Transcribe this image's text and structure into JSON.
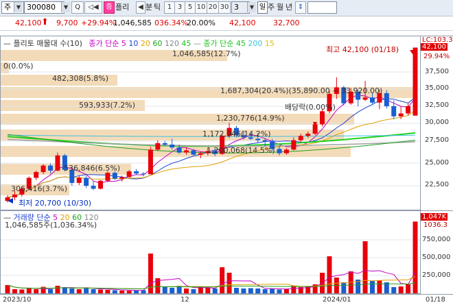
{
  "toolbar": {
    "type_label": "주",
    "code": "300080",
    "btn_search": "Q",
    "btn_speaker": "◁◀",
    "tag_jeung": "증",
    "company": "플리",
    "nav_left": "◀",
    "split_label": "분",
    "tick_label": "틱",
    "periods": [
      "1",
      "3",
      "5",
      "10",
      "20",
      "30"
    ],
    "period_selected": "3",
    "day_label": "일",
    "week_label": "주",
    "month_label": "월",
    "year_label": "년",
    "updown": "⇕"
  },
  "quote": {
    "price": "42,100",
    "change": "9,700",
    "change_pct": "+29.94%",
    "volume": "1,046,585",
    "vol_pct": "036.34%",
    "ratio": "20.00%",
    "high": "42,100",
    "low": "32,700"
  },
  "legend": {
    "name": "플리토 매물대 수(10)",
    "ma_label": "종가 단순",
    "ma_periods": [
      "5",
      "10",
      "20",
      "60",
      "120",
      "45"
    ],
    "ma_label2": "종가 단순",
    "ma_periods2": [
      "45",
      "200",
      "15"
    ],
    "vol_name": "거래량 단순",
    "vol_periods": [
      "5",
      "20",
      "60",
      "120"
    ],
    "vol_value": "1,046,585주(1,036.34%)"
  },
  "annotations": {
    "supply": [
      "1,046,585(12.7%)",
      "0(0.0%)",
      "482,308(5.8%)",
      "1,687,304(20.4%)(35,890.00 ~ 33,920.00)",
      "593,933(7.2%)",
      "1,230,776(14.9%)",
      "1,172,946(14.2%)",
      "1,200,068(14.5%)",
      "536,846(6.5%)",
      "306,416(3.7%)"
    ],
    "dividend": "배당락(0.00%)",
    "high_label": "최고 42,100 (01/18)",
    "low_label": "최저 20,700 (10/30)"
  },
  "price_axis": {
    "top_label": "LC:103.3",
    "current": "42,100",
    "current2": "29.94%",
    "ticks": [
      "37,500",
      "35,000",
      "32,500",
      "30,000",
      "27,500",
      "25,000",
      "22,500"
    ]
  },
  "vol_axis": {
    "current": "1,047K",
    "current2": "1036.3",
    "ticks": [
      "750,000",
      "500,000",
      "250,000"
    ]
  },
  "dates": [
    "2023/10",
    "12",
    "2024/01",
    "01/18"
  ],
  "colors": {
    "up": "#e8000b",
    "down": "#1a5fd0",
    "ma5": "#c000c0",
    "ma10": "#1a3fd0",
    "ma20": "#e0a000",
    "ma60": "#20a020",
    "ma120": "#a0a0a0",
    "ma45": "#20d020",
    "ma200": "#40c0e0",
    "supply": "#f0d2a8"
  },
  "chart_data": {
    "type": "candlestick",
    "ylim": [
      20000,
      43000
    ],
    "candles": [
      [
        20900,
        21700,
        20700,
        21400
      ],
      [
        21400,
        22300,
        21000,
        21800
      ],
      [
        21800,
        22900,
        21500,
        22600
      ],
      [
        22600,
        24300,
        22400,
        24100
      ],
      [
        24100,
        25100,
        23800,
        24900
      ],
      [
        24900,
        26000,
        24600,
        25800
      ],
      [
        25800,
        26100,
        24700,
        25100
      ],
      [
        25100,
        27600,
        25000,
        27200
      ],
      [
        27200,
        27400,
        25000,
        25200
      ],
      [
        25200,
        25600,
        23000,
        23400
      ],
      [
        23400,
        24400,
        23100,
        24100
      ],
      [
        24100,
        24400,
        22700,
        23000
      ],
      [
        23000,
        23700,
        22400,
        22600
      ],
      [
        22600,
        23800,
        22500,
        23700
      ],
      [
        23700,
        25000,
        23500,
        24800
      ],
      [
        24800,
        25000,
        23800,
        24000
      ],
      [
        24000,
        24400,
        23600,
        24200
      ],
      [
        24200,
        25200,
        24100,
        25000
      ],
      [
        25000,
        25300,
        24500,
        24700
      ],
      [
        24700,
        24900,
        24300,
        24600
      ],
      [
        24600,
        28400,
        24600,
        28000
      ],
      [
        28000,
        29300,
        27800,
        28900
      ],
      [
        28900,
        29200,
        28500,
        28700
      ],
      [
        28700,
        29500,
        28000,
        28300
      ],
      [
        28300,
        28700,
        27400,
        27600
      ],
      [
        27600,
        28300,
        27300,
        27900
      ],
      [
        27900,
        28100,
        27200,
        27300
      ],
      [
        27300,
        27700,
        26800,
        27500
      ],
      [
        27500,
        28200,
        27200,
        27800
      ],
      [
        27800,
        28100,
        27100,
        27400
      ],
      [
        27400,
        30100,
        27300,
        29900
      ],
      [
        29900,
        31700,
        29600,
        31000
      ],
      [
        31000,
        31300,
        29700,
        30000
      ],
      [
        30000,
        30600,
        29400,
        29700
      ],
      [
        29700,
        30300,
        29300,
        29500
      ],
      [
        29500,
        30300,
        28900,
        29300
      ],
      [
        29300,
        29600,
        28400,
        29100
      ],
      [
        29100,
        29500,
        27800,
        28100
      ],
      [
        28100,
        28500,
        27200,
        27500
      ],
      [
        27500,
        28200,
        27300,
        28000
      ],
      [
        28000,
        29700,
        27900,
        29300
      ],
      [
        29300,
        30200,
        29000,
        29900
      ],
      [
        29900,
        30500,
        29600,
        30200
      ],
      [
        30200,
        31700,
        30000,
        31500
      ],
      [
        31500,
        33600,
        31200,
        33300
      ],
      [
        33300,
        36100,
        33000,
        35700
      ],
      [
        35700,
        38000,
        35000,
        36600
      ],
      [
        36600,
        36800,
        34100,
        34400
      ],
      [
        34400,
        36500,
        34200,
        36000
      ],
      [
        36000,
        36300,
        34000,
        34900
      ],
      [
        34900,
        37500,
        34700,
        35200
      ],
      [
        35200,
        35800,
        34200,
        34500
      ],
      [
        34500,
        36300,
        33600,
        35800
      ],
      [
        35800,
        36200,
        33700,
        34000
      ],
      [
        34000,
        34800,
        32200,
        32600
      ],
      [
        32600,
        34000,
        32200,
        33000
      ],
      [
        33000,
        34400,
        32700,
        34000
      ],
      [
        32700,
        42100,
        32700,
        42100
      ]
    ],
    "volumes": [
      120000,
      60000,
      55000,
      70000,
      60000,
      95000,
      60000,
      110000,
      90000,
      70000,
      60000,
      80000,
      60000,
      55000,
      50000,
      45000,
      40000,
      38000,
      40000,
      45000,
      580000,
      220000,
      90000,
      80000,
      110000,
      70000,
      60000,
      90000,
      80000,
      70000,
      380000,
      300000,
      80000,
      70000,
      75000,
      70000,
      60000,
      65000,
      55000,
      60000,
      110000,
      90000,
      95000,
      130000,
      300000,
      540000,
      230000,
      160000,
      320000,
      200000,
      760000,
      180000,
      190000,
      160000,
      90000,
      100000,
      130000,
      1046585
    ]
  }
}
